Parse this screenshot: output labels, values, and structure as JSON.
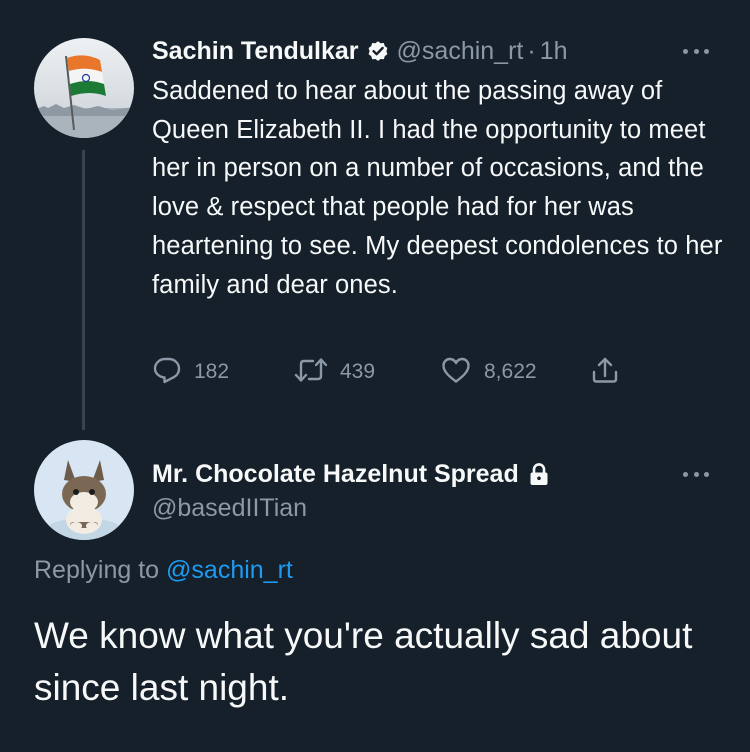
{
  "colors": {
    "background": "#15202b",
    "text_primary": "#f7f9f9",
    "text_secondary": "#8b98a5",
    "link": "#1d9bf0",
    "thread_line": "#38444d"
  },
  "tweet": {
    "display_name": "Sachin Tendulkar",
    "verified_icon": "verified-badge-icon",
    "handle": "@sachin_rt",
    "separator": "·",
    "time": "1h",
    "text": "Saddened to hear about the passing away of Queen Elizabeth II. I had the opportunity to meet her in person on a number of occasions, and the love & respect that people had for her was heartening to see. My deepest condolences to her family and dear ones.",
    "actions": {
      "reply_count": "182",
      "retweet_count": "439",
      "like_count": "8,622"
    }
  },
  "reply": {
    "display_name": "Mr. Chocolate Hazelnut Spread",
    "lock_icon": "lock-icon",
    "handle": "@basedIITian",
    "replying_prefix": "Replying to",
    "replying_to": "@sachin_rt",
    "text": "We know what you're actually sad about since last night."
  }
}
